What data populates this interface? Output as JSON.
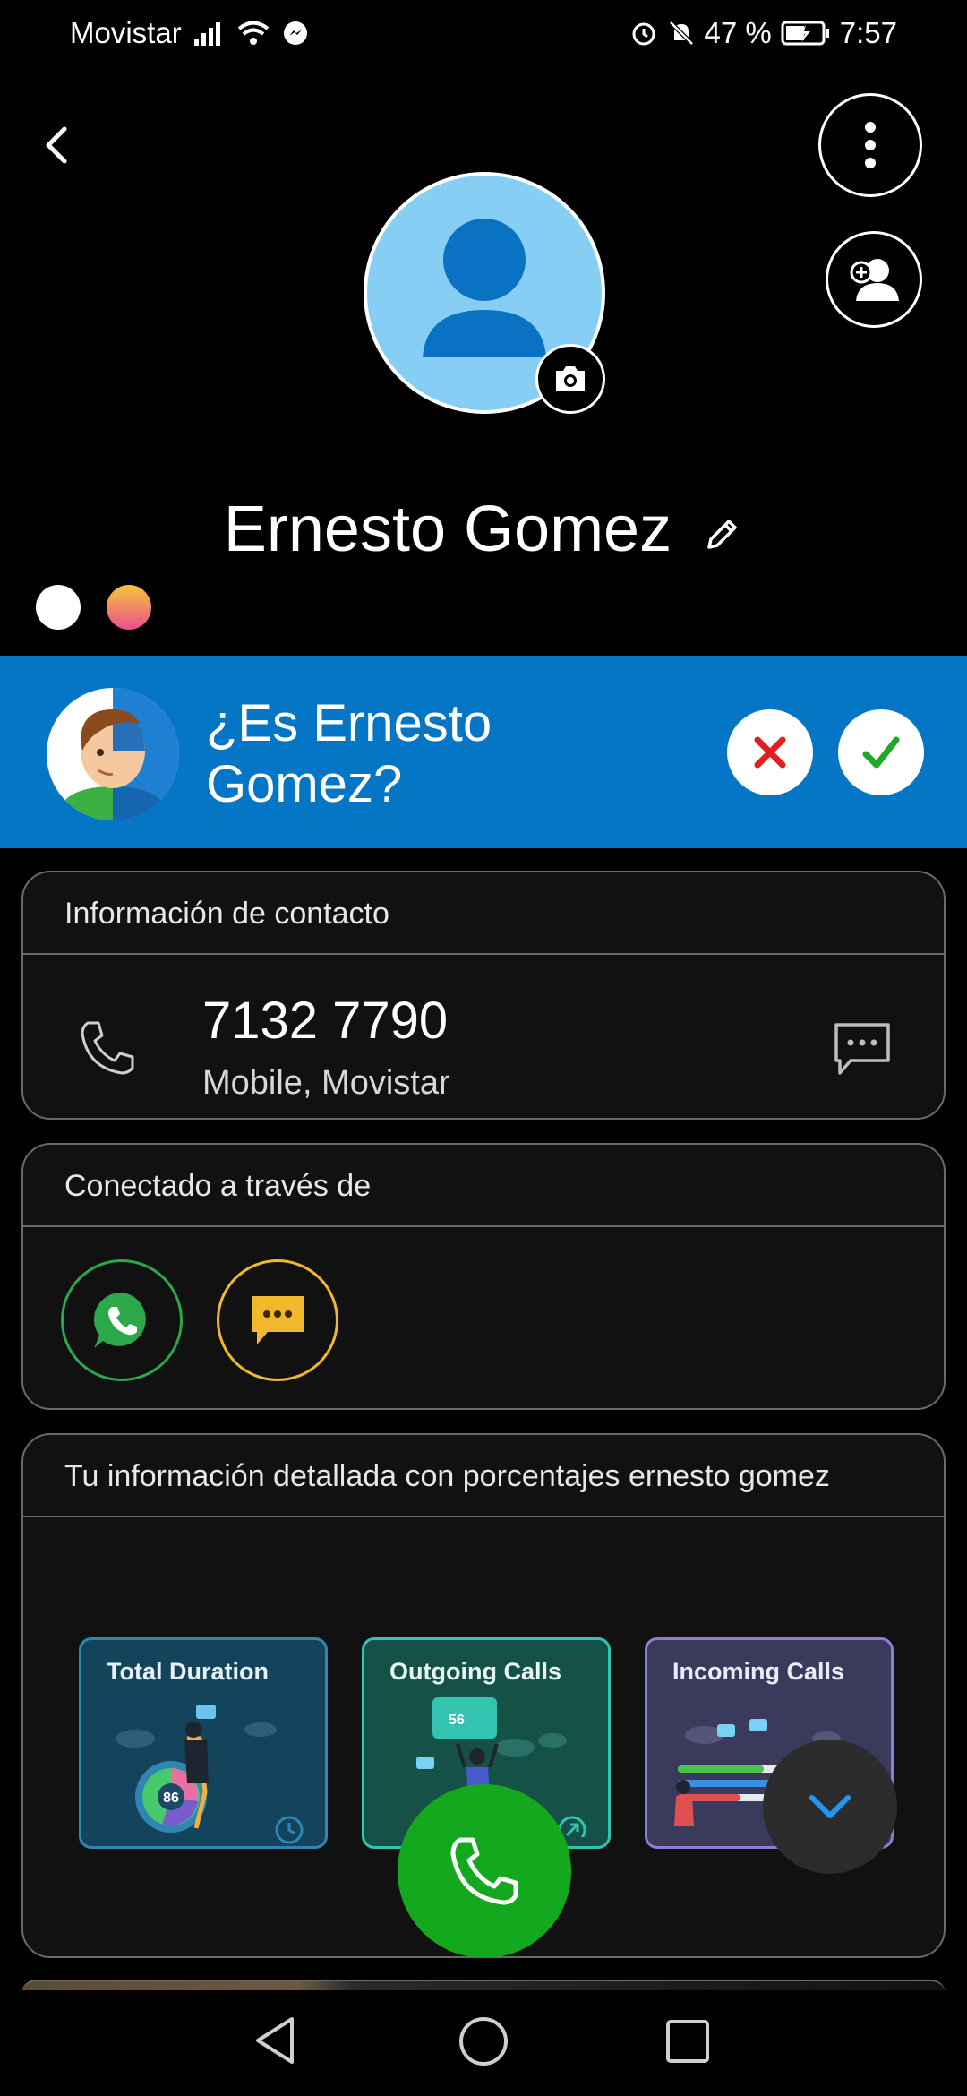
{
  "status_bar": {
    "carrier": "Movistar",
    "battery": "47 %",
    "time": "7:57"
  },
  "contact": {
    "name": "Ernesto Gomez"
  },
  "suggestion_banner": {
    "question": "¿Es Ernesto Gomez?"
  },
  "contact_info": {
    "header": "Información de contacto",
    "phone": "7132 7790",
    "phone_type": "Mobile, Movistar"
  },
  "connected": {
    "header": "Conectado a través de"
  },
  "details": {
    "header": "Tu información detallada con porcentajes ernesto gomez",
    "tiles": [
      {
        "title": "Total Duration",
        "value": "86"
      },
      {
        "title": "Outgoing Calls",
        "value": "56"
      },
      {
        "title": "Incoming Calls"
      }
    ]
  },
  "colors": {
    "banner": "#0575C5",
    "avatar_bg": "#87CEF5",
    "call_button": "#14A81E",
    "whatsapp": "#2BA84A",
    "message": "#F1B82D"
  },
  "icons": [
    "back-icon",
    "more-vert-icon",
    "add-contact-icon",
    "camera-icon",
    "edit-icon",
    "close-icon",
    "check-icon",
    "phone-icon",
    "message-icon",
    "whatsapp-icon",
    "chat-icon",
    "call-icon",
    "chevron-down-icon",
    "nav-back-icon",
    "nav-home-icon",
    "nav-recents-icon"
  ]
}
